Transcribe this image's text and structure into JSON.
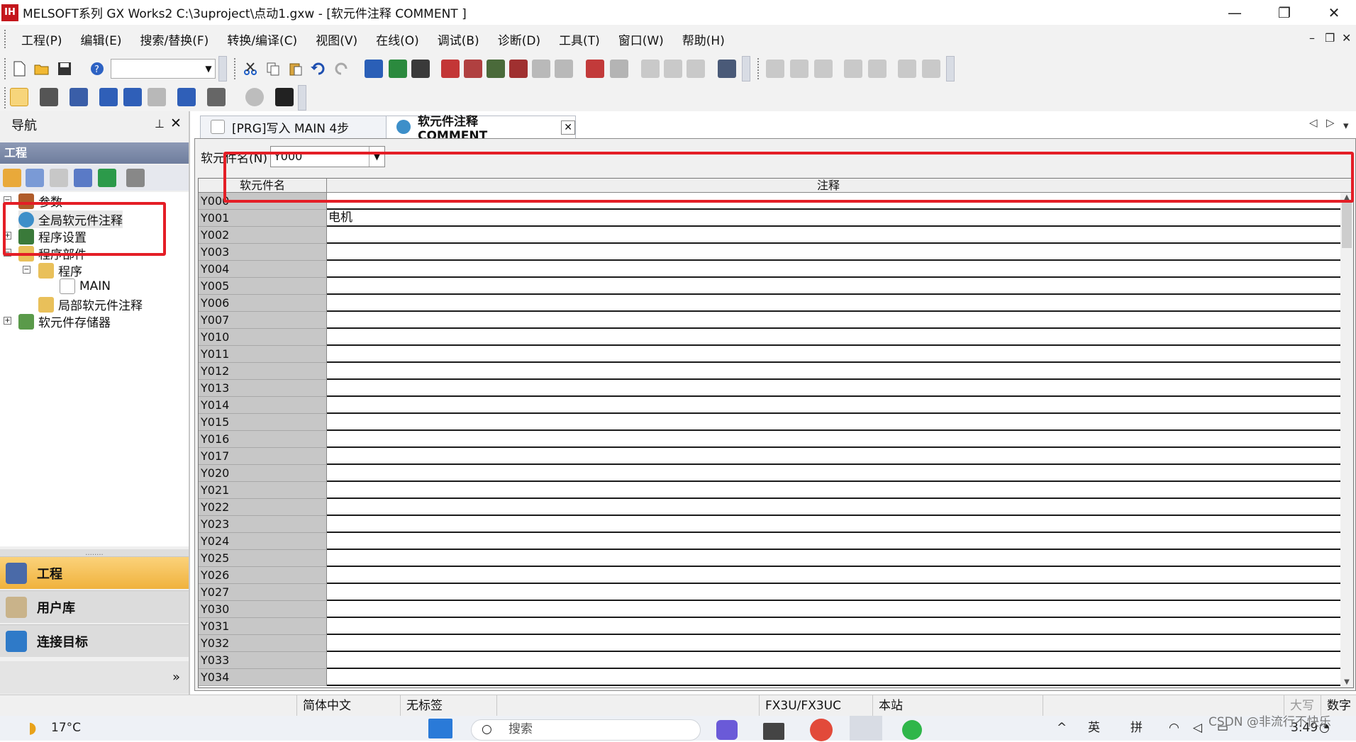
{
  "window": {
    "title": "MELSOFT系列 GX Works2 C:\\3uproject\\点动1.gxw - [软元件注释 COMMENT ]",
    "app_icon_text": "IH",
    "minimize": "—",
    "restore": "❐",
    "close": "✕"
  },
  "menu": {
    "items": [
      "工程(P)",
      "编辑(E)",
      "搜索/替换(F)",
      "转换/编译(C)",
      "视图(V)",
      "在线(O)",
      "调试(B)",
      "诊断(D)",
      "工具(T)",
      "窗口(W)",
      "帮助(H)"
    ],
    "mdi_min": "–",
    "mdi_restore": "❐",
    "mdi_close": "✕"
  },
  "navigation": {
    "title": "导航",
    "pin": "⊥",
    "close": "✕",
    "project_bar": "工程",
    "tree": [
      {
        "label": "参数",
        "level": 0
      },
      {
        "label": "全局软元件注释",
        "level": 0
      },
      {
        "label": "程序设置",
        "level": 0
      },
      {
        "label": "程序部件",
        "level": 0
      },
      {
        "label": "程序",
        "level": 1
      },
      {
        "label": "MAIN",
        "level": 2
      },
      {
        "label": "局部软元件注释",
        "level": 1
      },
      {
        "label": "软元件存储器",
        "level": 0
      }
    ],
    "splitter": "........",
    "buttons": [
      "工程",
      "用户库",
      "连接目标"
    ],
    "more": "»"
  },
  "tabs": [
    {
      "label": "[PRG]写入 MAIN 4步"
    },
    {
      "label": "软元件注释 COMMENT",
      "close": "✕"
    }
  ],
  "tab_nav": {
    "left": "◁",
    "right": "▷",
    "dropdown": "▾"
  },
  "editor": {
    "device_name_label": "软元件名(N)",
    "device_name_value": "Y000",
    "columns": {
      "name": "软元件名",
      "comment": "注释"
    },
    "rows": [
      {
        "name": "Y000",
        "comment": ""
      },
      {
        "name": "Y001",
        "comment": "电机"
      },
      {
        "name": "Y002",
        "comment": ""
      },
      {
        "name": "Y003",
        "comment": ""
      },
      {
        "name": "Y004",
        "comment": ""
      },
      {
        "name": "Y005",
        "comment": ""
      },
      {
        "name": "Y006",
        "comment": ""
      },
      {
        "name": "Y007",
        "comment": ""
      },
      {
        "name": "Y010",
        "comment": ""
      },
      {
        "name": "Y011",
        "comment": ""
      },
      {
        "name": "Y012",
        "comment": ""
      },
      {
        "name": "Y013",
        "comment": ""
      },
      {
        "name": "Y014",
        "comment": ""
      },
      {
        "name": "Y015",
        "comment": ""
      },
      {
        "name": "Y016",
        "comment": ""
      },
      {
        "name": "Y017",
        "comment": ""
      },
      {
        "name": "Y020",
        "comment": ""
      },
      {
        "name": "Y021",
        "comment": ""
      },
      {
        "name": "Y022",
        "comment": ""
      },
      {
        "name": "Y023",
        "comment": ""
      },
      {
        "name": "Y024",
        "comment": ""
      },
      {
        "name": "Y025",
        "comment": ""
      },
      {
        "name": "Y026",
        "comment": ""
      },
      {
        "name": "Y027",
        "comment": ""
      },
      {
        "name": "Y030",
        "comment": ""
      },
      {
        "name": "Y031",
        "comment": ""
      },
      {
        "name": "Y032",
        "comment": ""
      },
      {
        "name": "Y033",
        "comment": ""
      },
      {
        "name": "Y034",
        "comment": ""
      }
    ]
  },
  "statusbar": {
    "language": "简体中文",
    "label": "无标签",
    "cpu": "FX3U/FX3UC",
    "station": "本站",
    "caps": "大写",
    "num": "数字"
  },
  "taskbar": {
    "weather": "17°C",
    "search_placeholder": "搜索",
    "ime1": "英",
    "ime2": "拼",
    "time": "3:49",
    "watermark": "CSDN @非流行不快乐"
  },
  "colors": {
    "highlight_box": "#e41e26",
    "nav_active_button": "#f6c25a",
    "nav_project_bar": "#7f8bab",
    "device_name_column": "#c7c7c7"
  }
}
